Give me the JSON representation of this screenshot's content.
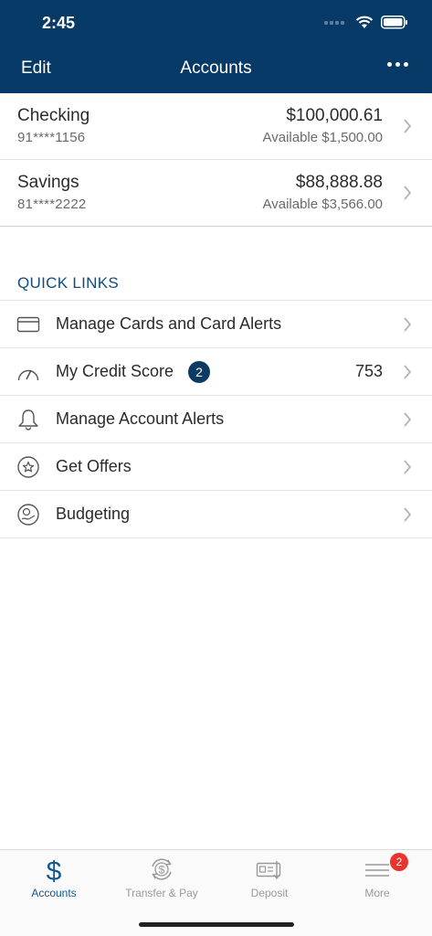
{
  "status": {
    "time": "2:45"
  },
  "nav": {
    "edit": "Edit",
    "title": "Accounts"
  },
  "accounts": [
    {
      "name": "Checking",
      "number": "91****1156",
      "balance": "$100,000.61",
      "available": "Available $1,500.00"
    },
    {
      "name": "Savings",
      "number": "81****2222",
      "balance": "$88,888.88",
      "available": "Available $3,566.00"
    }
  ],
  "quick_links": {
    "header": "QUICK LINKS",
    "items": [
      {
        "label": "Manage Cards and Card Alerts",
        "icon": "card-icon"
      },
      {
        "label": "My Credit Score",
        "icon": "gauge-icon",
        "badge": "2",
        "value": "753"
      },
      {
        "label": "Manage Account Alerts",
        "icon": "bell-icon"
      },
      {
        "label": "Get Offers",
        "icon": "star-icon"
      },
      {
        "label": "Budgeting",
        "icon": "budget-icon"
      }
    ]
  },
  "tabs": [
    {
      "label": "Accounts",
      "icon": "dollar-icon",
      "active": true
    },
    {
      "label": "Transfer & Pay",
      "icon": "transfer-icon"
    },
    {
      "label": "Deposit",
      "icon": "deposit-check-icon"
    },
    {
      "label": "More",
      "icon": "menu-icon",
      "badge": "2"
    }
  ],
  "colors": {
    "header": "#073a66",
    "accent": "#0f5896",
    "badge": "#0b3b63",
    "alert_badge": "#e8342d"
  }
}
